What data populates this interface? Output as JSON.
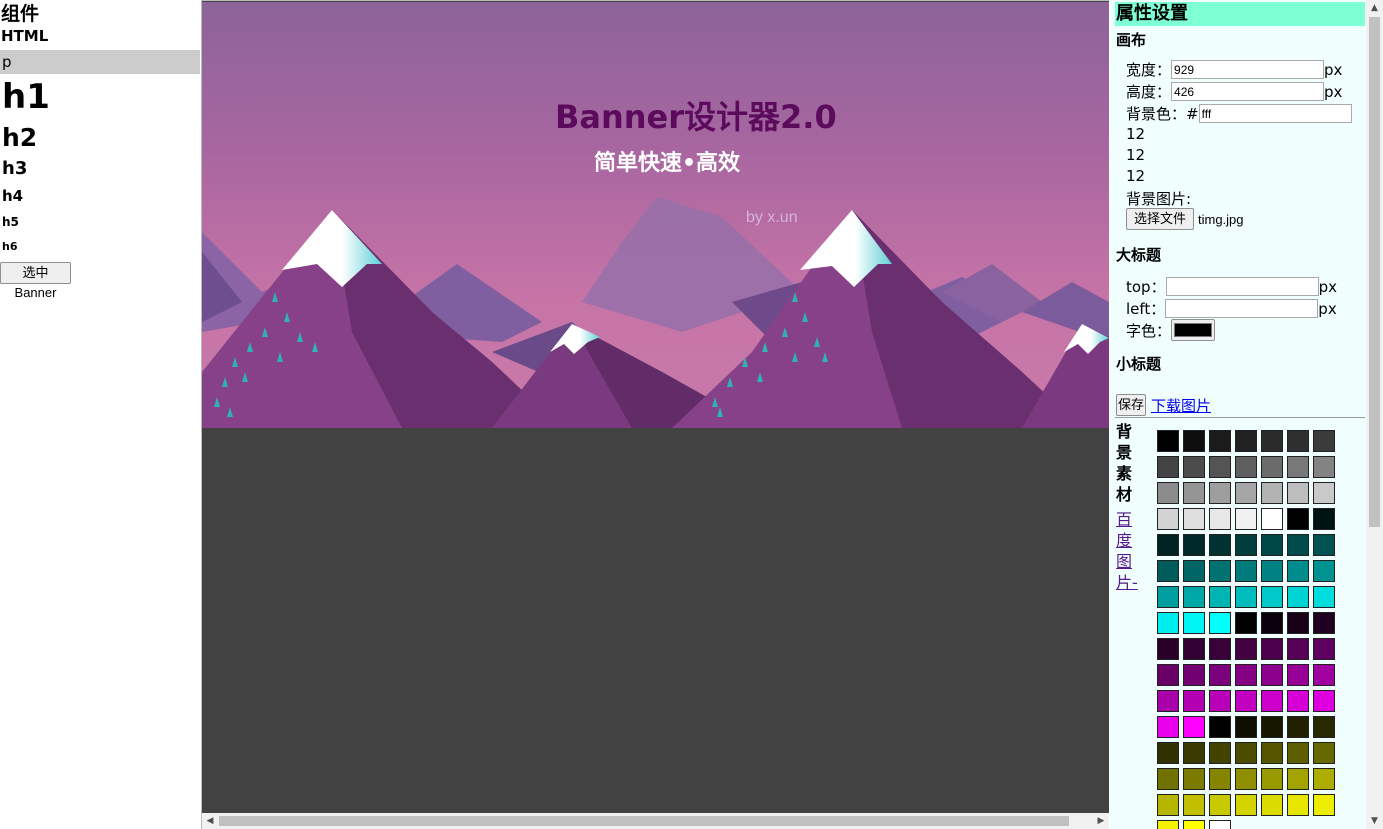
{
  "components": {
    "title": "组件",
    "html": "HTML",
    "p": "p",
    "h1": "h1",
    "h2": "h2",
    "h3": "h3",
    "h4": "h4",
    "h5": "h5",
    "h6": "h6",
    "select_banner": "选中Banner"
  },
  "banner": {
    "title": "Banner设计器2.0",
    "subtitle": "简单快速•高效",
    "by": "by x.un"
  },
  "props": {
    "header": "属性设置",
    "canvas_section": "画布",
    "width_label": "宽度：",
    "width_value": "929",
    "height_label": "高度：",
    "height_value": "426",
    "px": "px",
    "bg_color_label": "背景色：#",
    "bg_color_value": "fff",
    "numbers": [
      "12",
      "12",
      "12"
    ],
    "bg_image_label": "背景图片:",
    "choose_file": "选择文件",
    "file_name": "timg.jpg",
    "big_title_section": "大标题",
    "top_label": "top：",
    "top_value": "",
    "left_label": "left：",
    "left_value": "",
    "font_color_label": "字色：",
    "font_color": "#000000",
    "small_title_section": "小标题",
    "save": "保存",
    "download": "下载图片",
    "bg_material": [
      "背",
      "景",
      "素",
      "材"
    ],
    "baidu_link": [
      "百",
      "度",
      "图",
      "片-"
    ]
  },
  "swatch_colors": [
    "#000000",
    "#0e0e0e",
    "#1b1b1b",
    "#212121",
    "#2b2b2b",
    "#2f2f2f",
    "#3b3b3b",
    "#444444",
    "#4c4c4c",
    "#545454",
    "#5f5f5f",
    "#6b6b6b",
    "#787878",
    "#838383",
    "#8c8c8c",
    "#959595",
    "#9e9e9e",
    "#a6a6a6",
    "#b3b3b3",
    "#bdbdbd",
    "#c9c9c9",
    "#d3d3d3",
    "#dedede",
    "#e8e8e8",
    "#f0f0f0",
    "#ffffff",
    "#000000",
    "#001313",
    "#002222",
    "#002a2a",
    "#003232",
    "#003d3d",
    "#004848",
    "#004b4b",
    "#005252",
    "#005b5b",
    "#006565",
    "#007272",
    "#007a7a",
    "#008282",
    "#008c8c",
    "#009191",
    "#009e9e",
    "#00a7a7",
    "#00b4b4",
    "#00bdbd",
    "#00c9c9",
    "#00d3d3",
    "#00dddd",
    "#00eded",
    "#00f5f5",
    "#00ffff",
    "#000000",
    "#0c000c",
    "#180018",
    "#200020",
    "#2a002a",
    "#320032",
    "#3a003a",
    "#430043",
    "#4d004d",
    "#570057",
    "#600060",
    "#680068",
    "#720072",
    "#7b007b",
    "#850085",
    "#8d008d",
    "#960096",
    "#a000a0",
    "#a900a9",
    "#b300b3",
    "#b700b7",
    "#c200c2",
    "#cb00cb",
    "#d600d6",
    "#df00df",
    "#ea00ea",
    "#ff00ff",
    "#000000",
    "#0d0d00",
    "#171700",
    "#212100",
    "#292900",
    "#313100",
    "#3a3a00",
    "#434300",
    "#4c4c00",
    "#565600",
    "#5e5e00",
    "#686800",
    "#717100",
    "#7b7b00",
    "#858500",
    "#8e8e00",
    "#999900",
    "#a3a300",
    "#adad00",
    "#b6b600",
    "#c0c000",
    "#c9c900",
    "#d3d300",
    "#dbdb00",
    "#e6e600",
    "#eded00",
    "#f3f300",
    "#ffff00",
    "#ffffff"
  ]
}
